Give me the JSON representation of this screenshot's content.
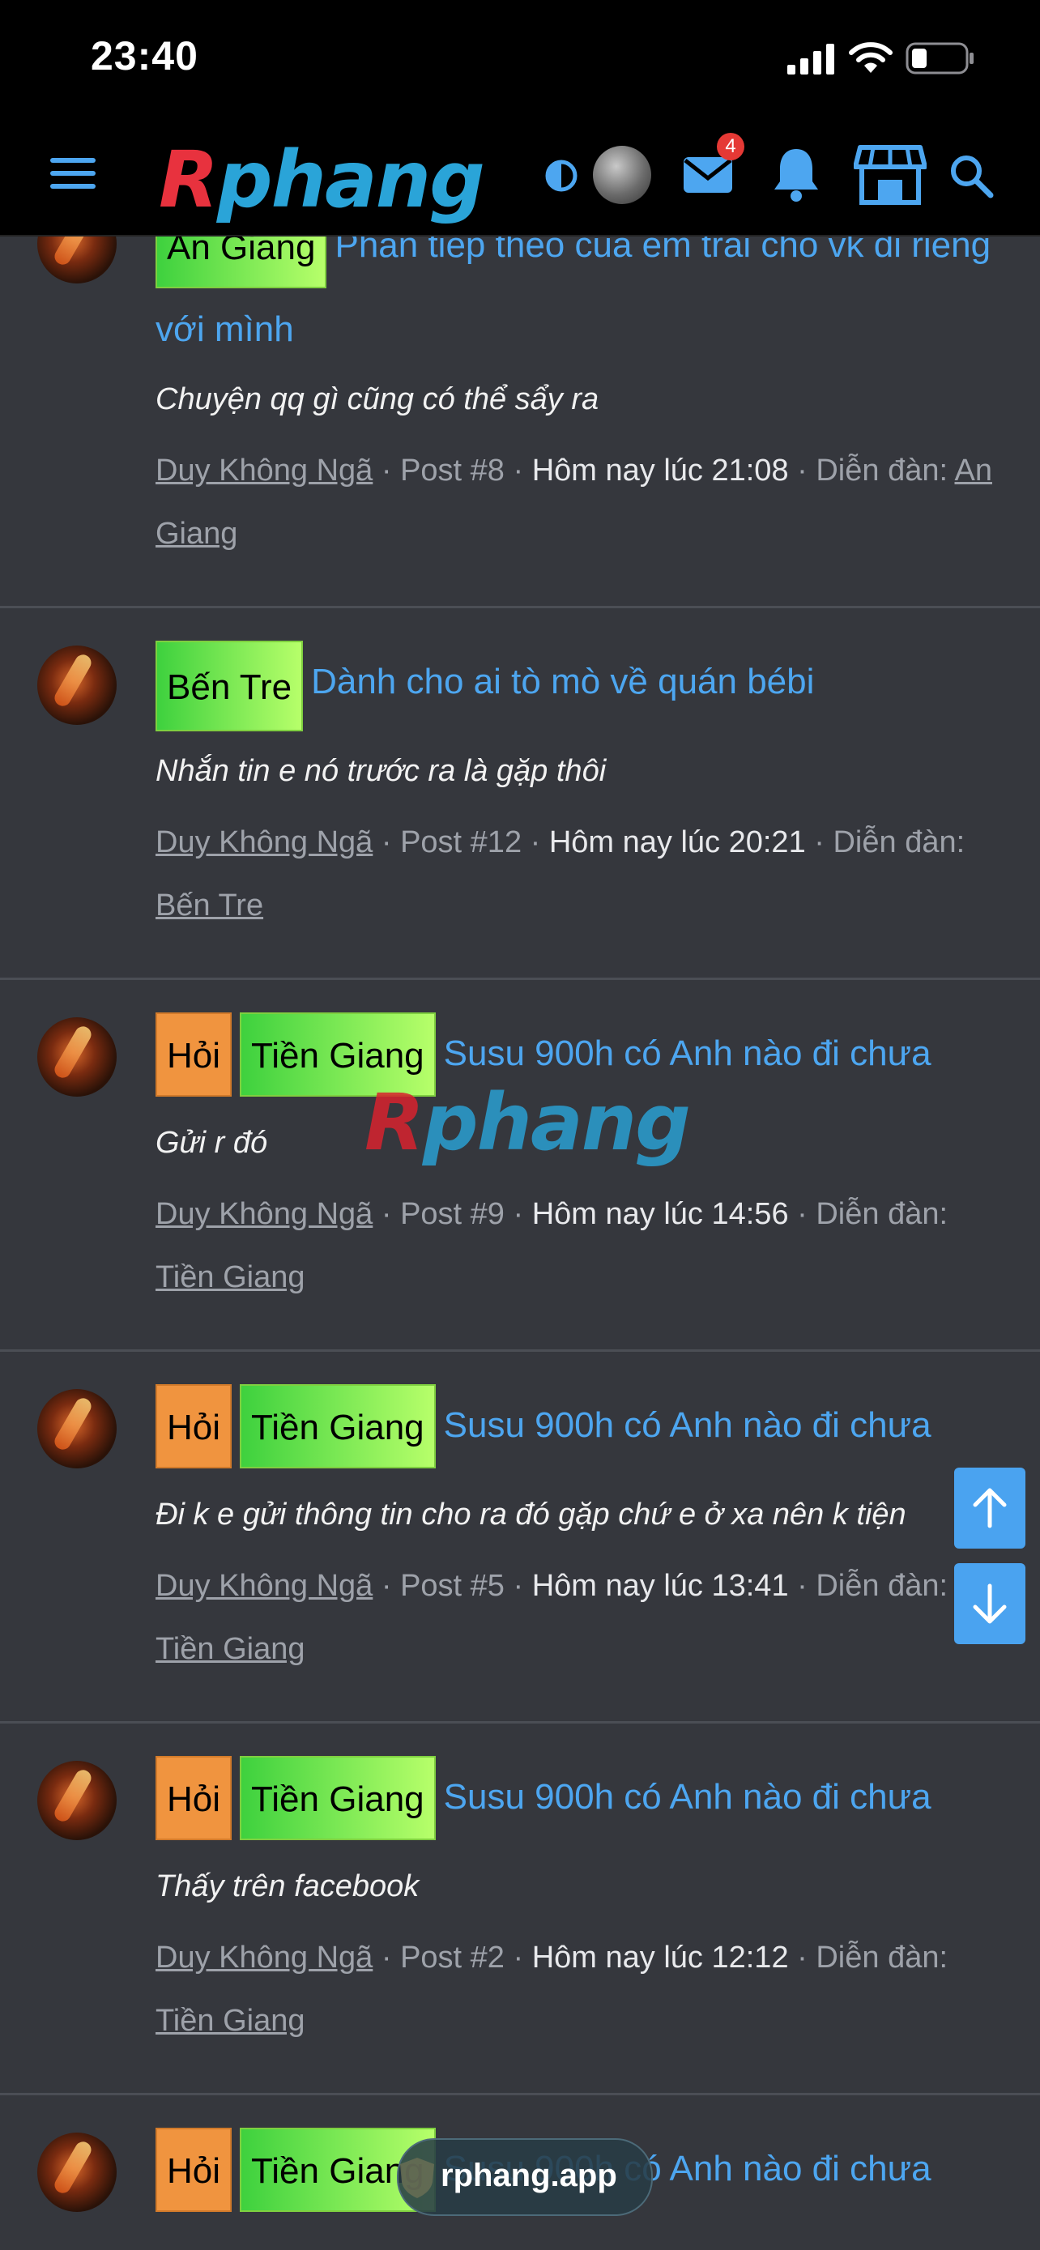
{
  "status": {
    "time": "23:40"
  },
  "nav": {
    "logo_r": "R",
    "logo_rest": "phang",
    "badge_count": "4"
  },
  "items": [
    {
      "tags": [
        "An Giang"
      ],
      "title": "Phần tiếp theo của em trai cho vk đi riêng với mình",
      "snippet": "Chuyện qq gì cũng có thể sẩy ra",
      "author": "Duy Không Ngã",
      "post": "Post #8",
      "time": "Hôm nay lúc 21:08",
      "forum_label": "Diễn đàn:",
      "forum": "An Giang"
    },
    {
      "tags": [
        "Bến Tre"
      ],
      "title": "Dành cho ai tò mò về quán bébi",
      "snippet": "Nhắn tin e nó trước ra là gặp thôi",
      "author": "Duy Không Ngã",
      "post": "Post #12",
      "time": "Hôm nay lúc 20:21",
      "forum_label": "Diễn đàn:",
      "forum": "Bến Tre"
    },
    {
      "tags": [
        "Hỏi",
        "Tiền Giang"
      ],
      "title": "Susu 900h có Anh nào đi chưa",
      "snippet": "Gửi r đó",
      "author": "Duy Không Ngã",
      "post": "Post #9",
      "time": "Hôm nay lúc 14:56",
      "forum_label": "Diễn đàn:",
      "forum": "Tiền Giang"
    },
    {
      "tags": [
        "Hỏi",
        "Tiền Giang"
      ],
      "title": "Susu 900h có Anh nào đi chưa",
      "snippet": "Đi k e gửi thông tin cho ra đó gặp chứ e ở xa nên k tiện",
      "author": "Duy Không Ngã",
      "post": "Post #5",
      "time": "Hôm nay lúc 13:41",
      "forum_label": "Diễn đàn:",
      "forum": "Tiền Giang"
    },
    {
      "tags": [
        "Hỏi",
        "Tiền Giang"
      ],
      "title": "Susu 900h có Anh nào đi chưa",
      "snippet": "Thấy trên facebook",
      "author": "Duy Không Ngã",
      "post": "Post #2",
      "time": "Hôm nay lúc 12:12",
      "forum_label": "Diễn đàn:",
      "forum": "Tiền Giang"
    },
    {
      "tags": [
        "Hỏi",
        "Tiền Giang"
      ],
      "title": "Susu 900h có Anh nào đi chưa"
    }
  ],
  "watermark": {
    "r": "R",
    "rest": "phang"
  },
  "app_pill": {
    "label": "rphang.app"
  },
  "colors": {
    "link": "#4da6f0",
    "tag_orange": "#f0943f",
    "tag_green": "#3ed13e",
    "accent_blue": "#4aa3f0",
    "badge_red": "#e53935"
  }
}
